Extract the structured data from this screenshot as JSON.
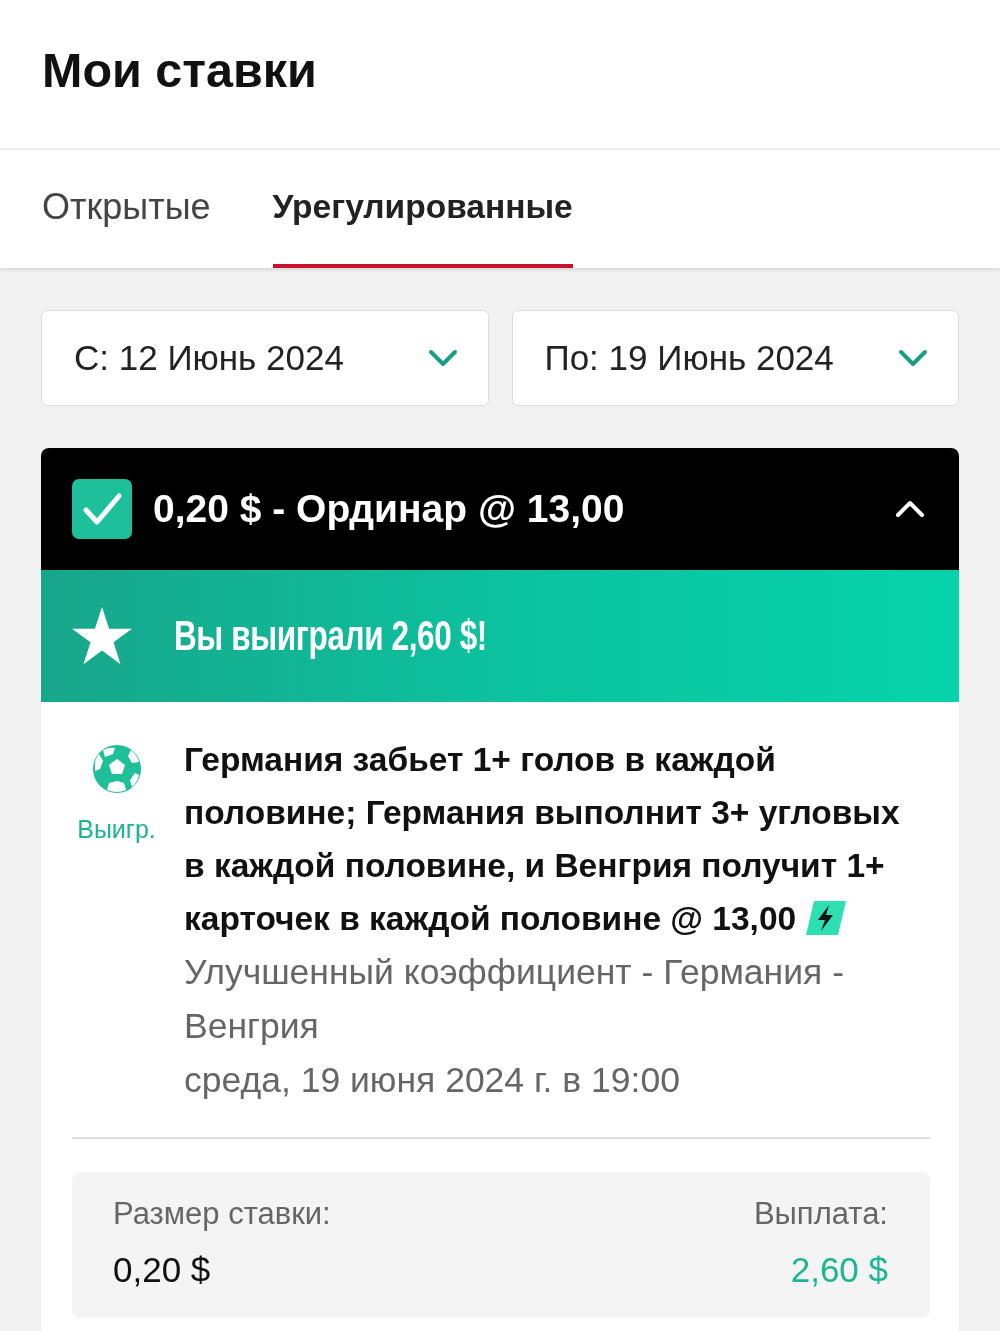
{
  "header": {
    "title": "Мои ставки"
  },
  "tabs": [
    {
      "label": "Открытые",
      "selected": false
    },
    {
      "label": "Урегулированные",
      "selected": true
    }
  ],
  "date_filters": [
    {
      "label": "С: 12 Июнь 2024"
    },
    {
      "label": "По: 19 Июнь 2024"
    }
  ],
  "bet": {
    "title": "0,20 $ - Ординар @ 13,00",
    "checked": true,
    "expanded": true,
    "win_message": "Вы выиграли 2,60 $!",
    "status": "Выигр.",
    "selection": "Германия забьет 1+ голов в каждой половине; Германия выполнит 3+ угловых в каждой половине, и Венгрия получит 1+ карточек в каждой половине @ 13,00",
    "boosted": true,
    "market": "Улучшенный коэффициент - Германия - Венгрия",
    "date": "среда, 19 июня 2024 г. в 19:00",
    "stake": {
      "label": "Размер ставки:",
      "value": "0,20 $"
    },
    "payout": {
      "label": "Выплата:",
      "value": "2,60 $"
    }
  }
}
